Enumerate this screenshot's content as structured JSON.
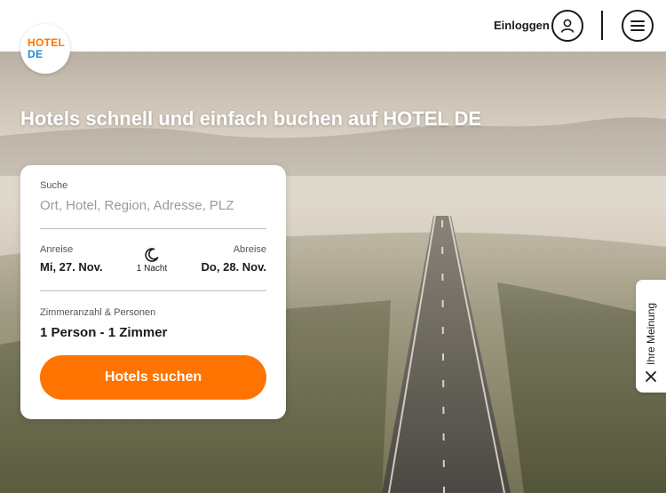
{
  "brand": {
    "logo_line1": "HOTEL",
    "logo_line2": "DE"
  },
  "header": {
    "login_label": "Einloggen"
  },
  "hero": {
    "title": "Hotels schnell und einfach buchen auf HOTEL DE"
  },
  "search_card": {
    "search_label": "Suche",
    "search_placeholder": "Ort, Hotel, Region, Adresse, PLZ",
    "checkin_label": "Anreise",
    "checkin_value": "Mi, 27. Nov.",
    "nights_label": "1 Nacht",
    "checkout_label": "Abreise",
    "checkout_value": "Do, 28. Nov.",
    "rooms_label": "Zimmeranzahl & Personen",
    "rooms_value": "1 Person - 1 Zimmer",
    "submit_label": "Hotels suchen"
  },
  "feedback_tab": {
    "label": "Ihre Meinung"
  },
  "colors": {
    "accent": "#ff7300",
    "brand_blue": "#1f8ad8",
    "text_dark": "#1a1a1a"
  },
  "icons": [
    "user-icon",
    "menu-icon",
    "moon-icon",
    "close-icon"
  ]
}
